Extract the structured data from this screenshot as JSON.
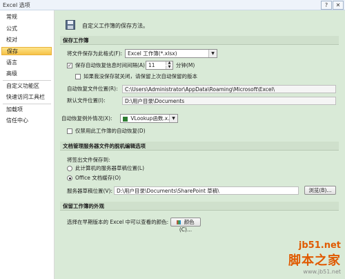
{
  "window": {
    "title": "Excel 选项",
    "help": "?",
    "close": "✕"
  },
  "sidebar": {
    "items": [
      {
        "label": "常规"
      },
      {
        "label": "公式"
      },
      {
        "label": "校对"
      },
      {
        "label": "保存"
      },
      {
        "label": "语言"
      },
      {
        "label": "高级"
      },
      {
        "label": "自定义功能区"
      },
      {
        "label": "快速访问工具栏"
      },
      {
        "label": "加载项"
      },
      {
        "label": "信任中心"
      }
    ],
    "active": "保存"
  },
  "header": {
    "text": "自定义工作簿的保存方法。",
    "icon": "save-icon"
  },
  "save_workbooks": {
    "title": "保存工作簿",
    "format_label": "将文件保存为此格式(F):",
    "format_value": "Excel 工作簿(*.xlsx)",
    "autorecover_label": "保存自动恢复信息时间间隔(A)",
    "autorecover_checked": true,
    "interval_value": "11",
    "minutes_label": "分钟(M)",
    "keep_last_label": "如果我没保存就关闭，请保留上次自动保留的版本",
    "keep_last_checked": false,
    "autorecover_loc_label": "自动恢复文件位置(R):",
    "autorecover_loc_value": "C:\\Users\\Administrator\\AppData\\Roaming\\Microsoft\\Excel\\",
    "default_loc_label": "默认文件位置(I):",
    "default_loc_value": "D:\\用户目录\\Documents"
  },
  "autorecover_exceptions": {
    "label": "自动恢复例外情况(X):",
    "value": "VLookup函数.x...",
    "disable_label": "仅禁用此工作簿的自动恢复(D)",
    "disable_checked": false
  },
  "offline_editing": {
    "title": "文档管理服务器文件的脱机编辑选项",
    "save_to_label": "将签出文件保存到:",
    "option1": "此计算机的服务器草稿位置(L)",
    "option2": "Office 文档缓存(O)",
    "selected": "option2",
    "drafts_label": "服务器草稿位置(V):",
    "drafts_value": "D:\\用户目录\\Documents\\SharePoint 草稿\\",
    "browse_label": "浏览(B)..."
  },
  "preserve_visual": {
    "title": "保留工作簿的外观",
    "colors_label": "选择在早期版本的 Excel 中可以查看的颜色:",
    "colors_button": "颜色(C)..."
  },
  "watermark": {
    "site": "jb51.net",
    "brand": "脚本之家",
    "url": "www.jb51.net"
  },
  "colors": {
    "active_tab": "#f6c247",
    "panel_bg": "#d9ead7",
    "section_bg": "#cfe0cc"
  }
}
